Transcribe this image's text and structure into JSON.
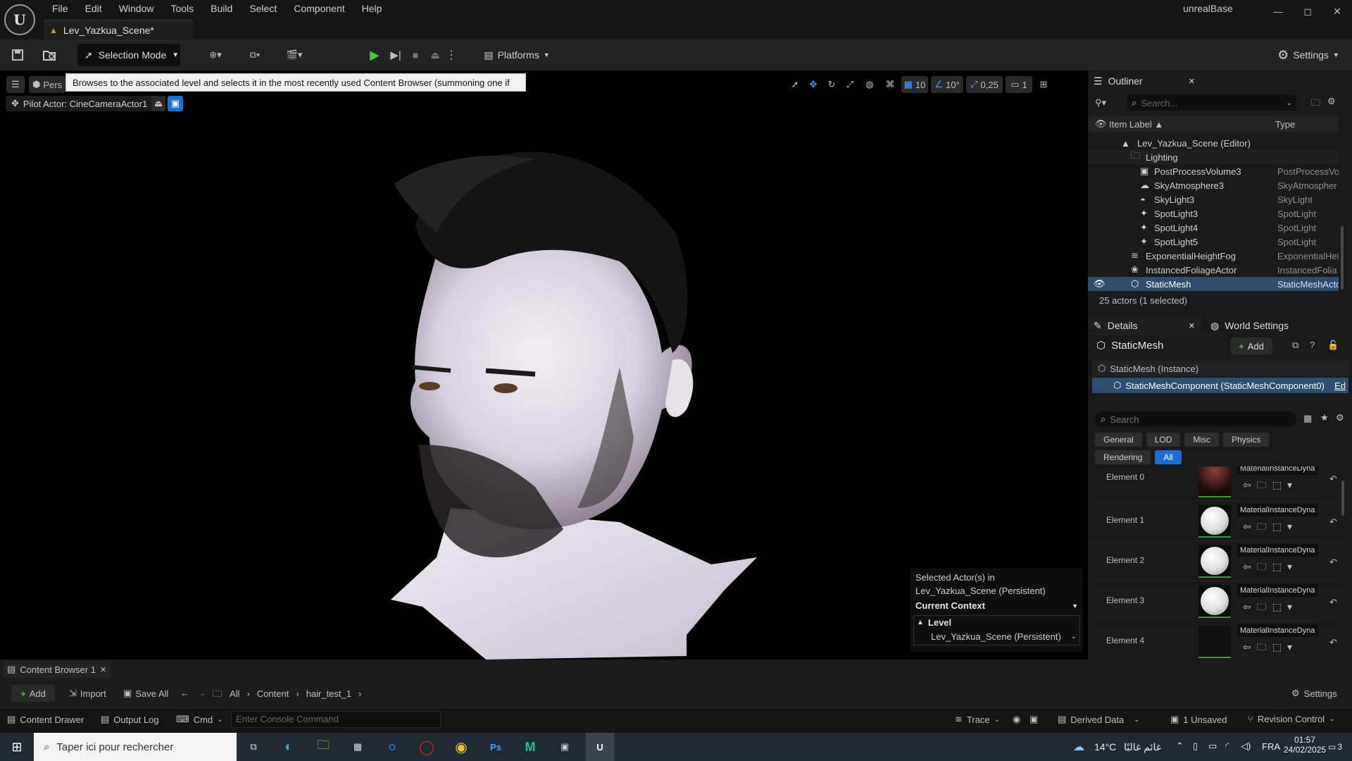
{
  "window": {
    "app_title": "unrealBase",
    "logo_text": "U",
    "minimize": "—",
    "maximize": "◻",
    "close": "✕"
  },
  "menu": [
    "File",
    "Edit",
    "Window",
    "Tools",
    "Build",
    "Select",
    "Component",
    "Help"
  ],
  "level_tab": {
    "label": "Lev_Yazkua_Scene*"
  },
  "toolbar": {
    "selection_mode": "Selection Mode",
    "platforms": "Platforms",
    "settings": "Settings"
  },
  "viewport": {
    "perspective": "Pers",
    "tooltip": "Browses to the associated level and selects it in the most recently used Content Browser (summoning one if necessary)",
    "pilot": "Pilot Actor: CineCameraActor1",
    "grid_snap": "10",
    "rot_snap": "10°",
    "scale_snap": "0,25",
    "camera_speed": "1",
    "context": {
      "line1": "Selected Actor(s) in",
      "line2": "Lev_Yazkua_Scene (Persistent)",
      "current_context": "Current Context",
      "level_label": "Level",
      "level_value": "Lev_Yazkua_Scene (Persistent)"
    }
  },
  "outliner": {
    "tab": "Outliner",
    "search_placeholder": "Search...",
    "col_label": "Item Label ▲",
    "col_type": "Type",
    "rows": [
      {
        "label": "Lev_Yazkua_Scene (Editor)",
        "type": ""
      },
      {
        "label": "Lighting",
        "type": ""
      },
      {
        "label": "PostProcessVolume3",
        "type": "PostProcessVo"
      },
      {
        "label": "SkyAtmosphere3",
        "type": "SkyAtmospher"
      },
      {
        "label": "SkyLight3",
        "type": "SkyLight"
      },
      {
        "label": "SpotLight3",
        "type": "SpotLight"
      },
      {
        "label": "SpotLight4",
        "type": "SpotLight"
      },
      {
        "label": "SpotLight5",
        "type": "SpotLight"
      },
      {
        "label": "ExponentialHeightFog",
        "type": "ExponentialHei"
      },
      {
        "label": "InstancedFoliageActor",
        "type": "InstancedFolia"
      },
      {
        "label": "StaticMesh",
        "type": "StaticMeshActo"
      }
    ],
    "footer": "25 actors (1 selected)"
  },
  "details": {
    "tab": "Details",
    "world_tab": "World Settings",
    "actor": "StaticMesh",
    "add": "Add",
    "instance": "StaticMesh (Instance)",
    "component": "StaticMeshComponent (StaticMeshComponent0)",
    "edit_hint": "Ed",
    "search_placeholder": "Search",
    "categories": [
      "General",
      "LOD",
      "Misc",
      "Physics",
      "Rendering",
      "All"
    ],
    "elements": [
      {
        "label": "Element 0",
        "material": "MaterialInstanceDyna"
      },
      {
        "label": "Element 1",
        "material": "MaterialInstanceDyna"
      },
      {
        "label": "Element 2",
        "material": "MaterialInstanceDyna"
      },
      {
        "label": "Element 3",
        "material": "MaterialInstanceDyna"
      },
      {
        "label": "Element 4",
        "material": "MaterialInstanceDyna"
      }
    ]
  },
  "content_browser": {
    "tab": "Content Browser 1",
    "add": "Add",
    "import": "Import",
    "save_all": "Save All",
    "path": [
      "All",
      "Content",
      "hair_test_1"
    ],
    "settings": "Settings"
  },
  "statusbar": {
    "drawer": "Content Drawer",
    "output_log": "Output Log",
    "cmd": "Cmd",
    "console_placeholder": "Enter Console Command",
    "trace": "Trace",
    "derived_data": "Derived Data",
    "unsaved": "1 Unsaved",
    "revision": "Revision Control"
  },
  "taskbar": {
    "search": "Taper ici pour rechercher",
    "weather": "14°C",
    "weather_text": "غائم غالبًا",
    "lang": "FRA",
    "time": "01:57",
    "date": "24/02/2025",
    "notif": "3"
  }
}
